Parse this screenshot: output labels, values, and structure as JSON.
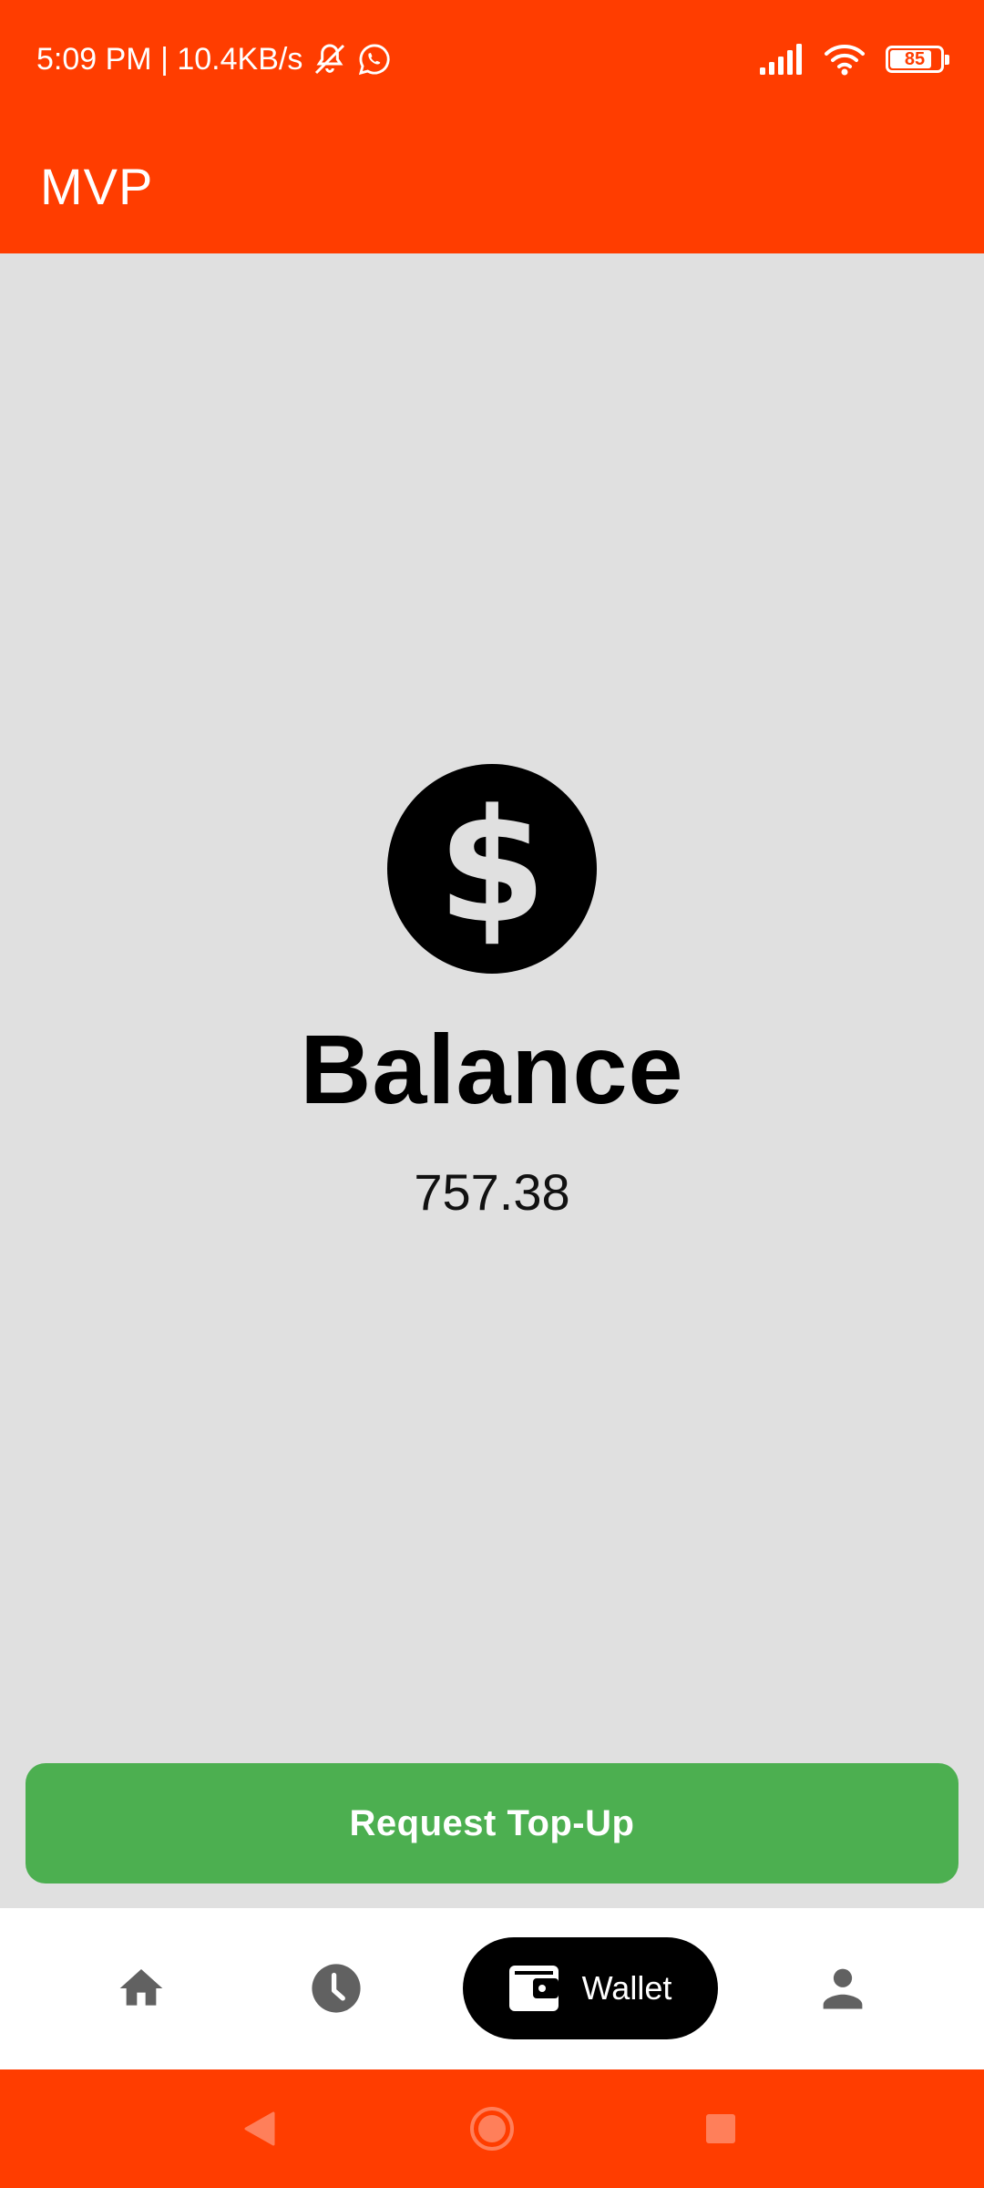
{
  "status_bar": {
    "time_speed": "5:09 PM | 10.4KB/s",
    "battery_level": "85",
    "battery_fraction": 0.85,
    "icons": [
      "bell-off-icon",
      "whatsapp-icon",
      "signal-icon",
      "wifi-icon",
      "battery-icon"
    ]
  },
  "app_bar": {
    "title": "MVP"
  },
  "balance": {
    "icon": "dollar-circle-icon",
    "title": "Balance",
    "amount": "757.38"
  },
  "actions": {
    "request_topup_label": "Request Top-Up"
  },
  "bottom_nav": {
    "items": [
      {
        "icon": "home-icon",
        "label": ""
      },
      {
        "icon": "clock-icon",
        "label": ""
      },
      {
        "icon": "wallet-icon",
        "label": "Wallet",
        "active": true
      },
      {
        "icon": "person-icon",
        "label": ""
      }
    ]
  },
  "system_nav": {
    "buttons": [
      "back-icon",
      "home-circle-icon",
      "recents-icon"
    ]
  },
  "colors": {
    "brand": "#ff3d00",
    "background": "#e0e0e0",
    "button_green": "#4caf50",
    "nav_active": "#000000",
    "icon_gray": "#616161"
  }
}
